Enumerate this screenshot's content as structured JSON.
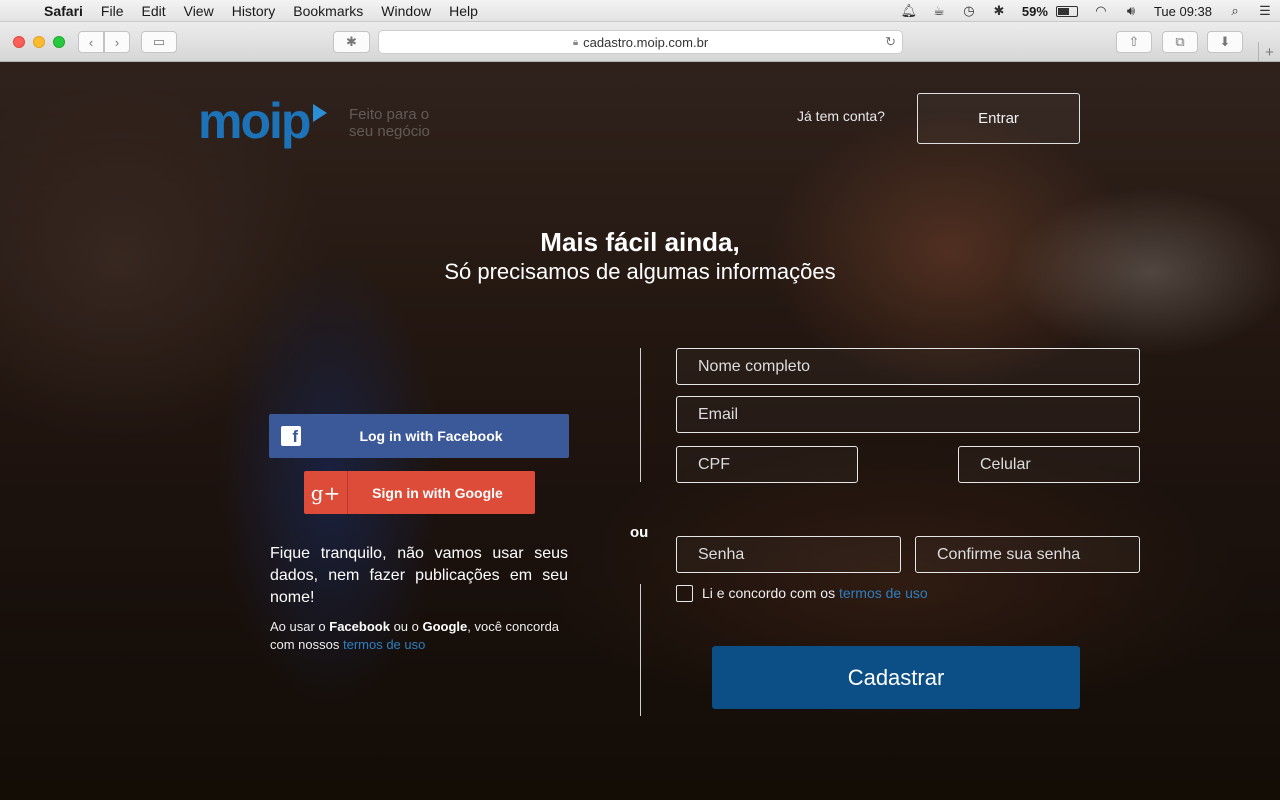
{
  "menubar": {
    "app": "Safari",
    "items": [
      "File",
      "Edit",
      "View",
      "History",
      "Bookmarks",
      "Window",
      "Help"
    ],
    "battery": "59%",
    "clock": "Tue 09:38",
    "battery_level": 0.59
  },
  "browser": {
    "url": "cadastro.moip.com.br"
  },
  "header": {
    "logo_text": "moip",
    "tagline_line1": "Feito para o",
    "tagline_line2": "seu negócio",
    "already_account": "Já tem conta?",
    "login_button": "Entrar"
  },
  "hero": {
    "title": "Mais fácil ainda,",
    "subtitle": "Só precisamos de algumas informações"
  },
  "social": {
    "facebook_label": "Log in with Facebook",
    "google_label": "Sign in with Google",
    "privacy_text": "Fique tranquilo, não vamos usar seus dados, nem fazer publicações em seu nome!",
    "usage_prefix": "Ao usar o ",
    "usage_facebook": "Facebook",
    "usage_or": " ou o ",
    "usage_google": "Google",
    "usage_suffix": ", você concorda com nossos ",
    "usage_terms_link": "termos de uso"
  },
  "separator": "ou",
  "form": {
    "name_placeholder": "Nome completo",
    "email_placeholder": "Email",
    "cpf_placeholder": "CPF",
    "phone_placeholder": "Celular",
    "password_placeholder": "Senha",
    "confirm_placeholder": "Confirme sua senha",
    "agree_text": "Li e concordo com os ",
    "agree_link": "termos de uso",
    "submit_label": "Cadastrar"
  }
}
